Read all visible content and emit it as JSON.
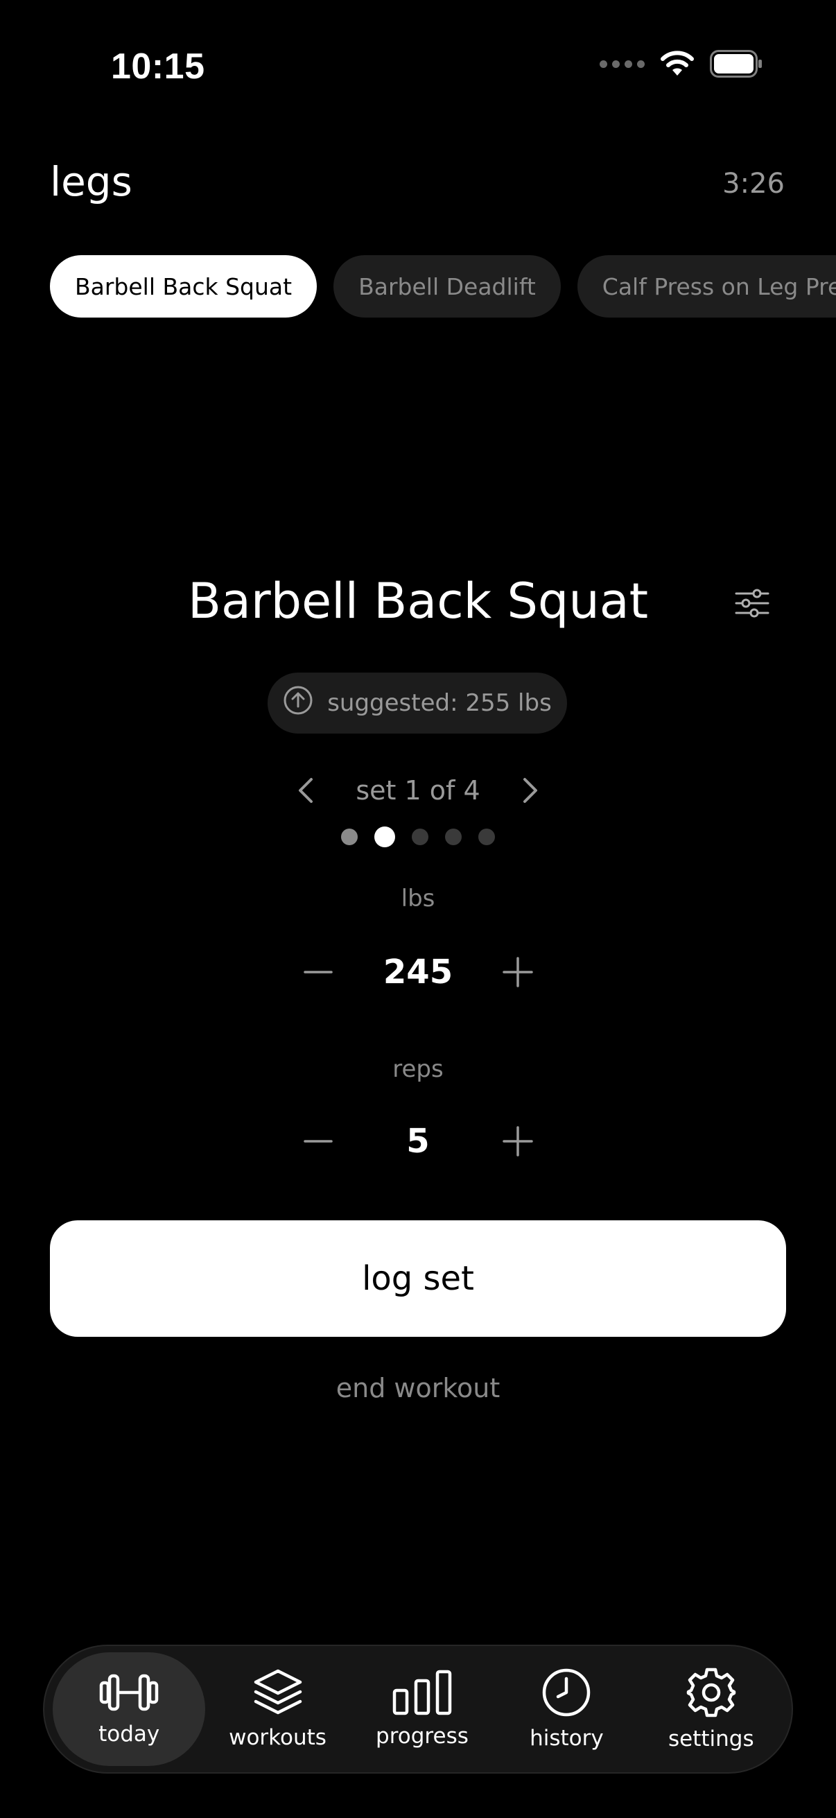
{
  "status_bar": {
    "time": "10:15",
    "wifi_icon": "wifi-icon",
    "battery_icon": "battery-icon"
  },
  "header": {
    "workout_title": "legs",
    "timer": "3:26"
  },
  "exercise_chips": [
    {
      "label": "Barbell Back Squat",
      "active": true
    },
    {
      "label": "Barbell Deadlift",
      "active": false
    },
    {
      "label": "Calf Press on Leg Press",
      "active": false
    }
  ],
  "exercise": {
    "name": "Barbell Back Squat",
    "settings_icon": "sliders-icon",
    "suggestion": "suggested: 255 lbs",
    "suggestion_icon": "arrow-up-circle-icon"
  },
  "set_nav": {
    "label": "set 1 of 4",
    "total_dots": 5,
    "current_dot_index": 1
  },
  "weight": {
    "unit_label": "lbs",
    "value": "245"
  },
  "reps": {
    "label": "reps",
    "value": "5"
  },
  "actions": {
    "log_label": "log set",
    "end_label": "end workout"
  },
  "tabbar": [
    {
      "label": "today",
      "icon": "dumbbell-icon",
      "active": true
    },
    {
      "label": "workouts",
      "icon": "layers-icon",
      "active": false
    },
    {
      "label": "progress",
      "icon": "bar-chart-icon",
      "active": false
    },
    {
      "label": "history",
      "icon": "clock-icon",
      "active": false
    },
    {
      "label": "settings",
      "icon": "gear-icon",
      "active": false
    }
  ],
  "colors": {
    "background": "#000000",
    "accent": "#ffffff",
    "muted_text": "#8a8a8a",
    "chip_bg": "#1e1e1e"
  }
}
